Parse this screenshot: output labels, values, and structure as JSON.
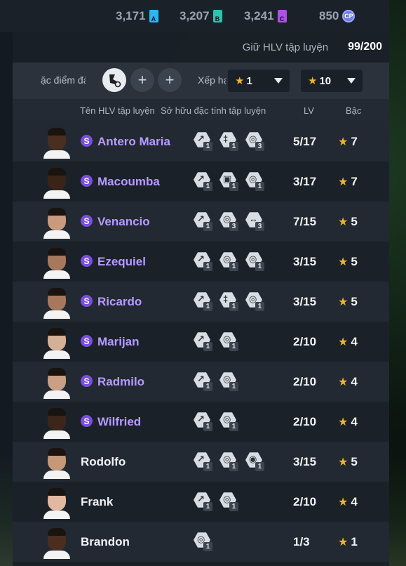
{
  "currencies": [
    {
      "value": "3,171",
      "badge": "A",
      "color": "#29b6f6"
    },
    {
      "value": "3,207",
      "badge": "B",
      "color": "#26c6b0"
    },
    {
      "value": "3,241",
      "badge": "C",
      "color": "#b14ee8"
    },
    {
      "value": "850",
      "badge": "CP",
      "color": "#6f7de0"
    }
  ],
  "hold": {
    "label": "Giữ HLV tập luyện",
    "value": "99/200"
  },
  "filter": {
    "trait_label": "ặc điểm đà",
    "rank_label": "Xếp hạ",
    "rank_min": "1",
    "rank_max": "10",
    "separator": "~"
  },
  "columns": {
    "name": "Tên HLV tập luyện",
    "traits": "Sở hữu đặc tính tập luyện",
    "lv": "LV",
    "rank": "Bậc"
  },
  "coaches": [
    {
      "name": "Antero Maria",
      "special": true,
      "traits": [
        {
          "icon": "kick-trait-icon",
          "level": "1"
        },
        {
          "icon": "whistle-trait-icon",
          "level": "1"
        },
        {
          "icon": "ball-trait-icon",
          "level": "3"
        }
      ],
      "lv": "5/17",
      "rank": "7",
      "skin": "#4a2e1f"
    },
    {
      "name": "Macoumba",
      "special": true,
      "traits": [
        {
          "icon": "kick-trait-icon",
          "level": "1"
        },
        {
          "icon": "lock-trait-icon",
          "level": "1"
        },
        {
          "icon": "ball-trait-icon",
          "level": "1"
        }
      ],
      "lv": "3/17",
      "rank": "7",
      "skin": "#3a2418"
    },
    {
      "name": "Venancio",
      "special": true,
      "traits": [
        {
          "icon": "kick-trait-icon",
          "level": "1"
        },
        {
          "icon": "ball-trait-icon",
          "level": "3"
        },
        {
          "icon": "tackle-trait-icon",
          "level": "3"
        }
      ],
      "lv": "7/15",
      "rank": "5",
      "skin": "#c99a7e"
    },
    {
      "name": "Ezequiel",
      "special": true,
      "traits": [
        {
          "icon": "kick-trait-icon",
          "level": "1"
        },
        {
          "icon": "ball-trait-icon",
          "level": "1"
        },
        {
          "icon": "ball-trait-icon",
          "level": "1"
        }
      ],
      "lv": "3/15",
      "rank": "5",
      "skin": "#a8785c"
    },
    {
      "name": "Ricardo",
      "special": true,
      "traits": [
        {
          "icon": "kick-trait-icon",
          "level": "1"
        },
        {
          "icon": "whistle-trait-icon",
          "level": "1"
        },
        {
          "icon": "ball-trait-icon",
          "level": "1"
        }
      ],
      "lv": "3/15",
      "rank": "5",
      "skin": "#a8785c"
    },
    {
      "name": "Marijan",
      "special": true,
      "traits": [
        {
          "icon": "kick-trait-icon",
          "level": "1"
        },
        {
          "icon": "ball-trait-icon",
          "level": "1"
        }
      ],
      "lv": "2/10",
      "rank": "4",
      "skin": "#d4b096"
    },
    {
      "name": "Radmilo",
      "special": true,
      "traits": [
        {
          "icon": "kick-trait-icon",
          "level": "1"
        },
        {
          "icon": "ball-trait-icon",
          "level": "1"
        }
      ],
      "lv": "2/10",
      "rank": "4",
      "skin": "#c9a085"
    },
    {
      "name": "Wilfried",
      "special": true,
      "traits": [
        {
          "icon": "kick-trait-icon",
          "level": "1"
        },
        {
          "icon": "ball-trait-icon",
          "level": "1"
        }
      ],
      "lv": "2/10",
      "rank": "4",
      "skin": "#3b2619"
    },
    {
      "name": "Rodolfo",
      "special": false,
      "traits": [
        {
          "icon": "kick-trait-icon",
          "level": "1"
        },
        {
          "icon": "ball-trait-icon",
          "level": "1"
        },
        {
          "icon": "header-trait-icon",
          "level": "1"
        }
      ],
      "lv": "3/15",
      "rank": "5",
      "skin": "#c49878"
    },
    {
      "name": "Frank",
      "special": false,
      "traits": [
        {
          "icon": "kick-trait-icon",
          "level": "1"
        },
        {
          "icon": "ball-trait-icon",
          "level": "1"
        }
      ],
      "lv": "2/10",
      "rank": "4",
      "skin": "#e1b8a0"
    },
    {
      "name": "Brandon",
      "special": false,
      "traits": [
        {
          "icon": "ball-trait-icon",
          "level": "1"
        }
      ],
      "lv": "1/3",
      "rank": "1",
      "skin": "#4a2e1f"
    }
  ]
}
